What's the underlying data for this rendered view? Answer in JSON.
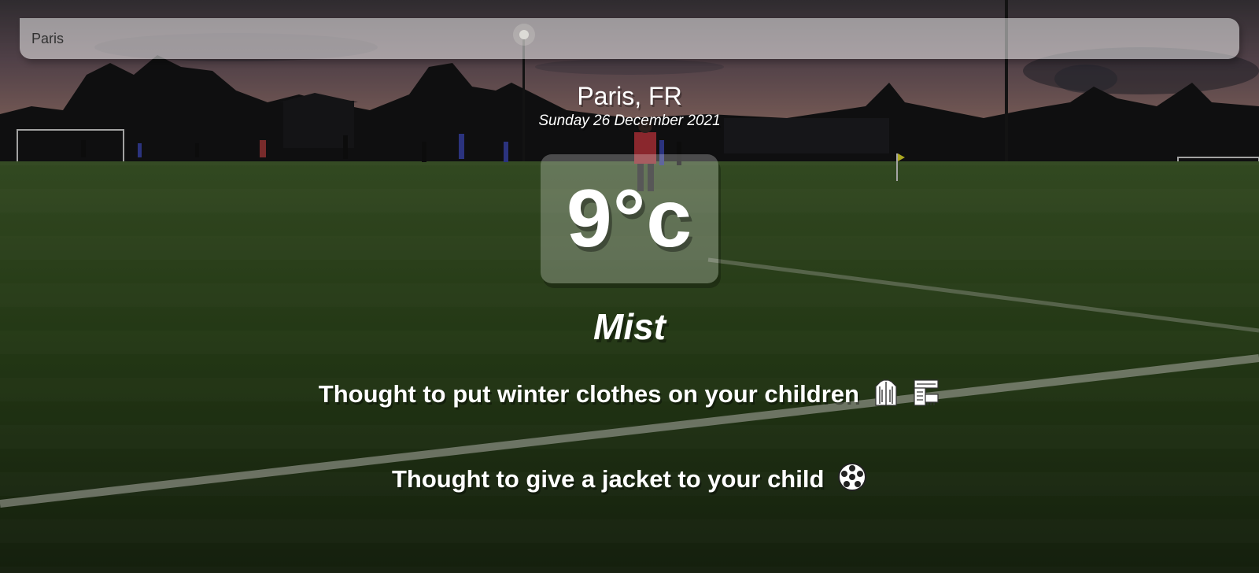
{
  "search": {
    "value": "Paris",
    "placeholder": ""
  },
  "location": {
    "city_country": "Paris, FR",
    "date": "Sunday 26 December 2021"
  },
  "weather": {
    "temperature": "9°c",
    "condition": "Mist"
  },
  "advice": [
    {
      "text": "Thought to put winter clothes on your children",
      "icons": [
        "coat-icon",
        "scarf-icon"
      ]
    },
    {
      "text": "Thought to give a jacket to your child",
      "icons": [
        "soccer-ball-icon"
      ]
    }
  ],
  "background": {
    "scene": "football-pitch-at-dusk"
  },
  "colors": {
    "text": "#ffffff",
    "input_text": "#313131",
    "grass": "#2f4a1c",
    "sky": "#6b5660"
  }
}
